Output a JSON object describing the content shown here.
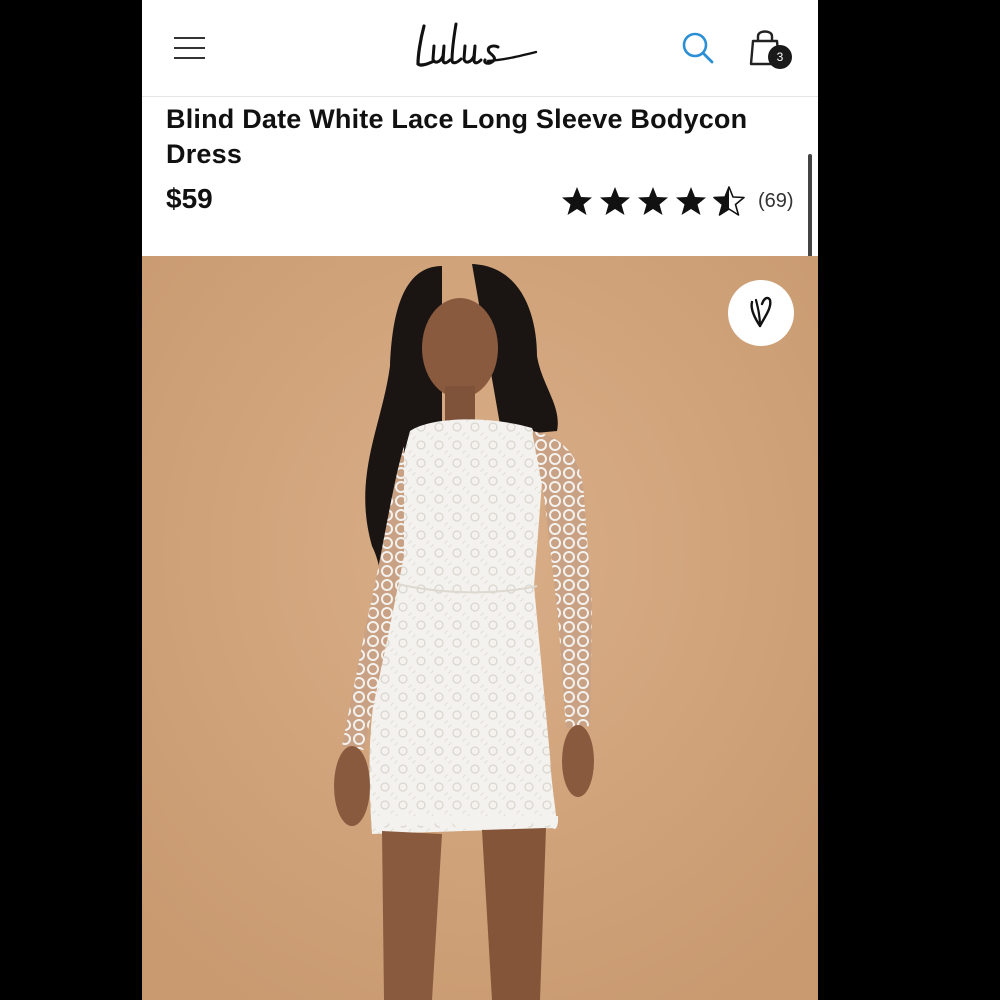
{
  "header": {
    "brand": "Lulus",
    "cart_count": "3"
  },
  "product": {
    "title": "Blind Date White Lace Long Sleeve Bodycon Dress",
    "price": "$59",
    "rating": {
      "value": 4.5,
      "max": 5,
      "count_label": "(69)"
    },
    "image_alt": "Model wearing white lace long sleeve bodycon dress"
  },
  "colors": {
    "hero_background": "#d1a47d",
    "search_icon": "#2b8fd6",
    "text": "#111111"
  },
  "icons": [
    "hamburger-menu-icon",
    "search-icon",
    "shopping-bag-icon",
    "heart-icon",
    "star-icon"
  ]
}
